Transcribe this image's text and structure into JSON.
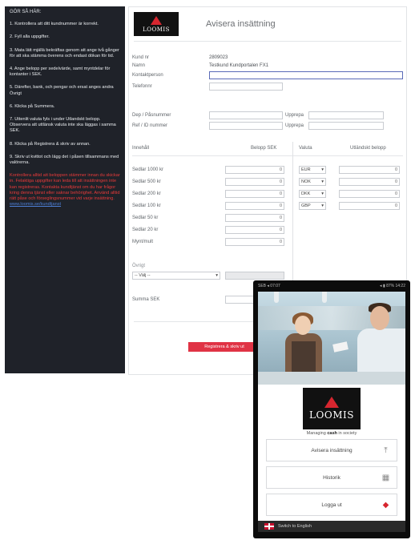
{
  "left_panel": {
    "title": "GÖR SÅ HÄR:",
    "steps": [
      "1. Kontrollera att ditt kundnummer är korrekt.",
      "2. Fyll alla uppgifter.",
      "3. Mata lätt mjällä bekräftas genom att ange två gånger för att ska stämma överens och endast dökan för tid.",
      "4. Ange belopp per sedelvärde, samt myntdelar för kontanter i SEK.",
      "5. Därefter, bank, och pengar och ersat anges andra Övrigt",
      "6. Klicka på Summera.",
      "7. Uttenlit valuta fyls i under Utlandskt belopp. Observera att uttlänsk valuta inte ska läggas i samma SEK.",
      "8. Klicka på Registrera & skriv av annan.",
      "9. Skriv ut kvittot och lägg det i påsen tillsammans med valörerna."
    ],
    "warning": "Kontrollera alltid att beloppen stämmer innan du skickar in. Felaktiga uppgifter kan leda till att insättningen inte kan registreras. Kontakta kundtjänst om du har frågor kring denna tjänst eller saknar behörighet. Använd alltid rätt påse och förseglingsnummer vid varje insättning.",
    "link": "www.loomis.se/kundtjanst"
  },
  "form": {
    "logo_text": "LOOMIS",
    "title": "Avisera insättning",
    "fields": [
      {
        "label": "Kund nr",
        "value": "2809023"
      },
      {
        "label": "Namn",
        "value": "Testkund Kundportalen FX1"
      },
      {
        "label": "Kontaktperson",
        "value": ""
      },
      {
        "label": "Telefonnr",
        "value": ""
      }
    ],
    "bag_label": "Dep / Påsnummer",
    "ref_label": "Ref / ID nummer",
    "repeat_label": "Upprepa",
    "col_deposit": "Innehåll",
    "col_amount": "Belopp SEK",
    "col_currency": "Valuta",
    "col_foreign": "Utländskt belopp",
    "denominations": [
      "Sedlar 1000 kr",
      "Sedlar 500 kr",
      "Sedlar 200 kr",
      "Sedlar 100 kr",
      "Sedlar 50 kr",
      "Sedlar 20 kr",
      "Mynt/mult"
    ],
    "amount_default": "0",
    "currencies": [
      "EUR",
      "NOK",
      "DKK",
      "GBP"
    ],
    "other_label": "Övrigt",
    "other_select": "-- Välj --",
    "sum_label": "Summa SEK",
    "submit_label": "Registrera & skriv ut"
  },
  "phone": {
    "status_left": "SEB ◂ 07:07",
    "status_right": "◂ ▮ 87% 14:22",
    "logo_text": "LOOMIS",
    "tagline_prefix": "Managing ",
    "tagline_bold": "cash",
    "tagline_suffix": " in society",
    "buttons": [
      {
        "label": "Avisera insättning",
        "icon": "upload-icon"
      },
      {
        "label": "Historik",
        "icon": "calendar-icon"
      },
      {
        "label": "Logga ut",
        "icon": "logout-icon"
      }
    ],
    "language_label": "Switch to English",
    "accent_red": "#d7262f"
  }
}
